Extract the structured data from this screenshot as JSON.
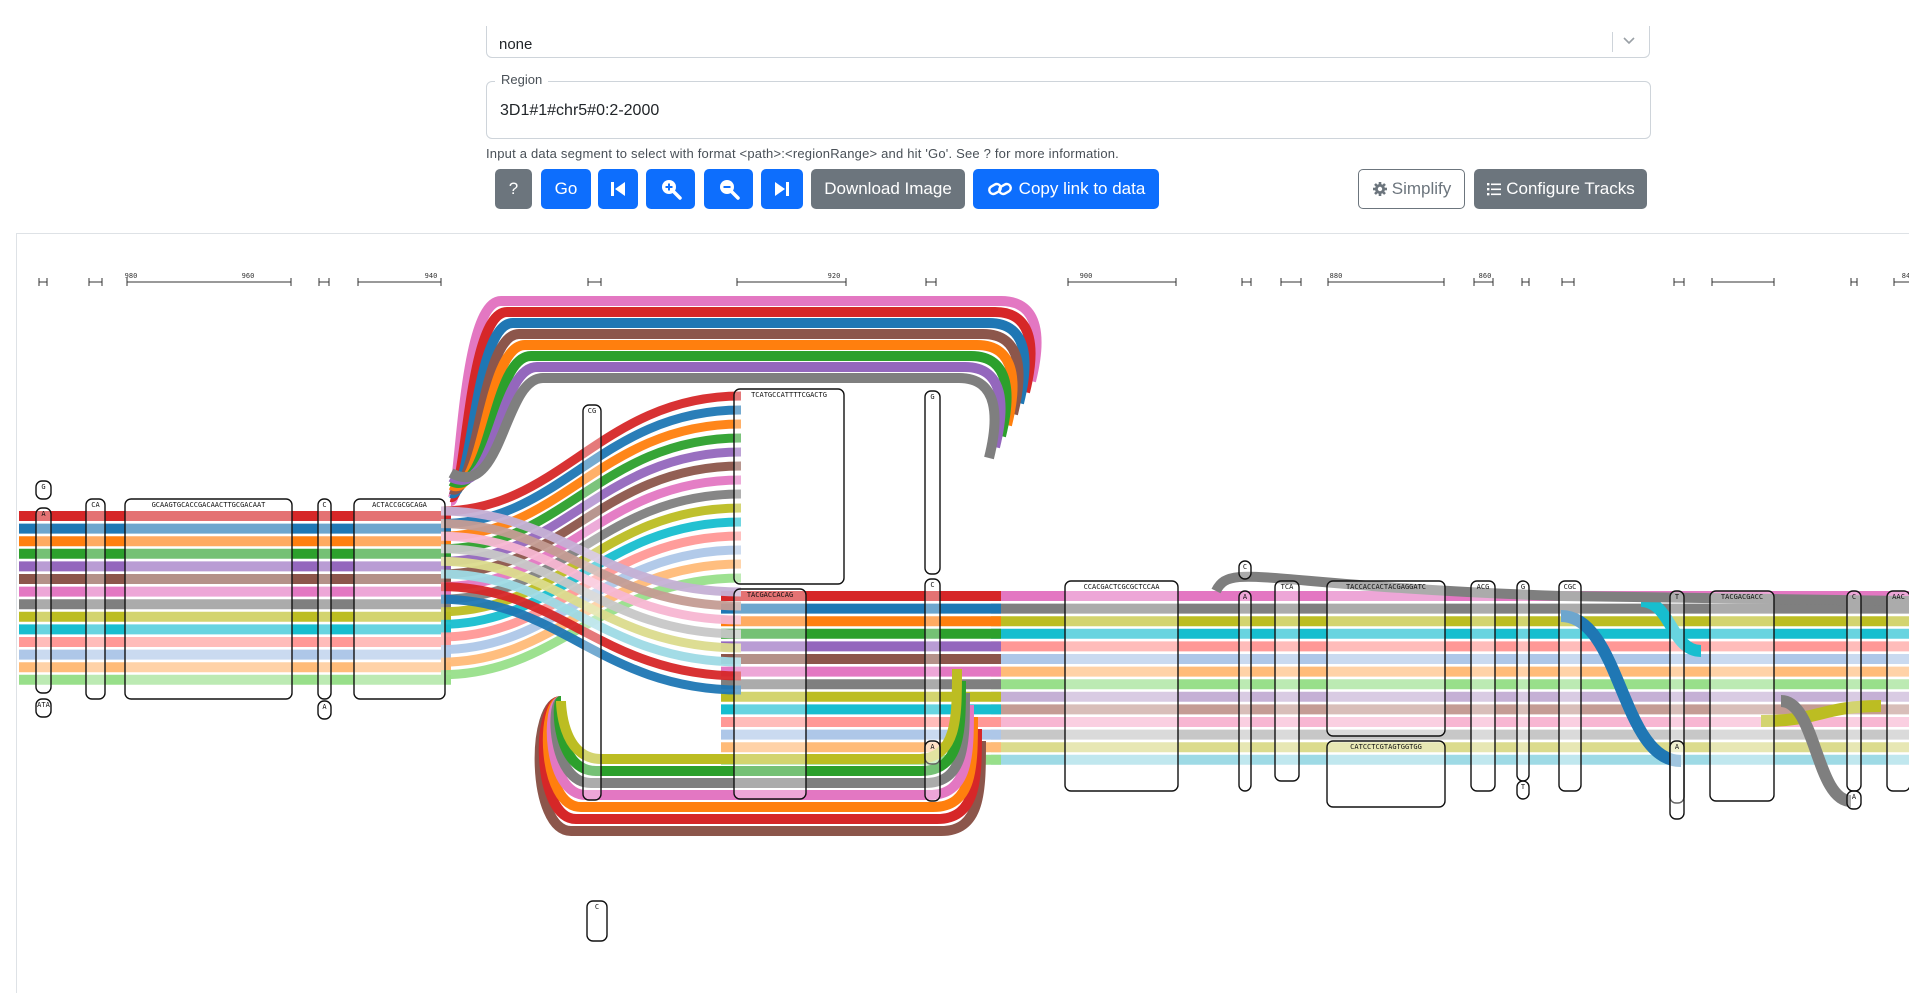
{
  "haplotype_select": {
    "value": "none",
    "chevron_icon": "chevron-down-icon"
  },
  "region": {
    "legend": "Region",
    "value": "3D1#1#chr5#0:2-2000",
    "help": "Input a data segment to select with format <path>:<regionRange> and hit 'Go'. See ? for more information."
  },
  "toolbar": {
    "help_label": "?",
    "go_label": "Go",
    "prev_icon": "skip-backward-icon",
    "zoom_in_icon": "zoom-in-icon",
    "zoom_out_icon": "zoom-out-icon",
    "next_icon": "skip-forward-icon",
    "download_label": "Download Image",
    "copy_link_label": "Copy link to data",
    "simplify_label": "Simplify",
    "configure_label": "Configure Tracks"
  },
  "colors": {
    "primary": "#0d6efd",
    "secondary": "#6c757d",
    "tracks": [
      "#d62728",
      "#1f77b4",
      "#ff7f0e",
      "#2ca02c",
      "#9467bd",
      "#8c564b",
      "#e377c2",
      "#7f7f7f",
      "#bcbd22",
      "#17becf",
      "#ff9896",
      "#aec7e8",
      "#ffbb78",
      "#98df8a",
      "#c5b0d5",
      "#c49c94",
      "#f7b6d2",
      "#c7c7c7",
      "#dbdb8d",
      "#9edae5"
    ]
  },
  "ruler_labels": [
    "980",
    "960",
    "940",
    "920",
    "900",
    "880",
    "860",
    "84"
  ],
  "nodes": [
    {
      "seq": "G"
    },
    {
      "seq": "A"
    },
    {
      "seq": "ATA"
    },
    {
      "seq": "CA"
    },
    {
      "seq": "GCAAGTGCACCGACAACTTGCGACAAT"
    },
    {
      "seq": "C"
    },
    {
      "seq": "A"
    },
    {
      "seq": "ACTACCGCGCAGA"
    },
    {
      "seq": "CG"
    },
    {
      "seq": "TCATGCCATTTTCGACTG"
    },
    {
      "seq": "G"
    },
    {
      "seq": "TACGACCACAG"
    },
    {
      "seq": "C"
    },
    {
      "seq": "A"
    },
    {
      "seq": "CCACGACTCGCGCTCCAA"
    },
    {
      "seq": "C"
    },
    {
      "seq": "A"
    },
    {
      "seq": "TCA"
    },
    {
      "seq": "TACCACCACTACGAGGATC"
    },
    {
      "seq": "CATCCTCGTAGTGGTGG"
    },
    {
      "seq": "ACG"
    },
    {
      "seq": "G"
    },
    {
      "seq": "T"
    },
    {
      "seq": "CGC"
    },
    {
      "seq": "T"
    },
    {
      "seq": "A"
    },
    {
      "seq": "TACGACGACC"
    },
    {
      "seq": "C"
    },
    {
      "seq": "A"
    },
    {
      "seq": "AAC"
    },
    {
      "seq": "C"
    }
  ]
}
